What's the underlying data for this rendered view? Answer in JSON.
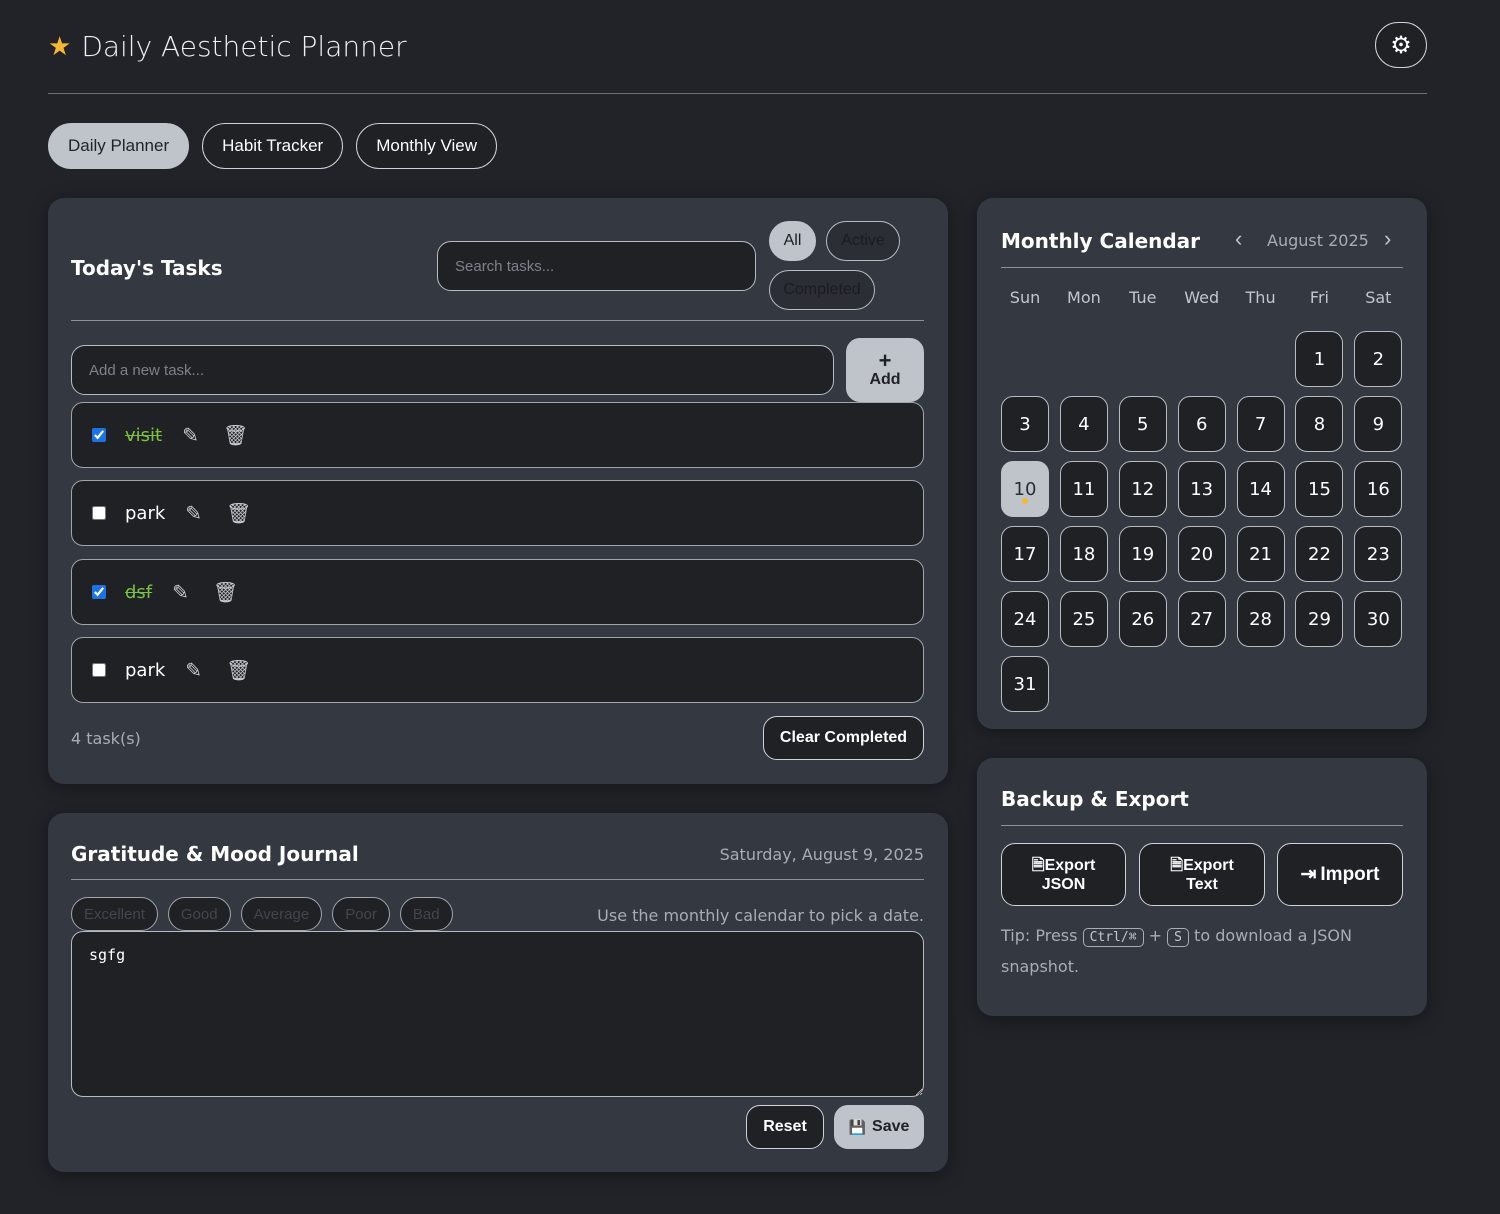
{
  "header": {
    "title": "Daily Aesthetic Planner",
    "star_icon": "star-icon",
    "theme_icon": "gear-icon"
  },
  "tabs": [
    {
      "label": "Daily Planner",
      "active": true
    },
    {
      "label": "Habit Tracker"
    },
    {
      "label": "Monthly View"
    }
  ],
  "tasks_card": {
    "title": "Today's Tasks",
    "search_placeholder": "Search tasks...",
    "filters": {
      "all": "All",
      "active": "Active",
      "completed": "Completed"
    },
    "add_placeholder": "Add a new task...",
    "add_plus": "+",
    "add_label": "Add",
    "items": [
      {
        "text": "visit",
        "done": true
      },
      {
        "text": "park",
        "done": false
      },
      {
        "text": "dsf",
        "done": true
      },
      {
        "text": "park",
        "done": false
      }
    ],
    "count": "4 task(s)",
    "clear_label": "Clear Completed"
  },
  "journal": {
    "title": "Gratitude & Mood Journal",
    "date": "Saturday, August 9, 2025",
    "moods": [
      "Excellent",
      "Good",
      "Average",
      "Poor",
      "Bad"
    ],
    "hint": "Use the monthly calendar to pick a date.",
    "entry": "sgfg",
    "reset_label": "Reset",
    "save_label": "Save"
  },
  "calendar": {
    "title": "Monthly Calendar",
    "month": "August 2025",
    "weekdays": [
      "Sun",
      "Mon",
      "Tue",
      "Wed",
      "Thu",
      "Fri",
      "Sat"
    ],
    "first_weekday": 5,
    "days": 31,
    "today": 10
  },
  "backup": {
    "title": "Backup & Export",
    "export_json": [
      "Export",
      "JSON"
    ],
    "export_text": [
      "Export",
      "Text"
    ],
    "import": "Import",
    "tip_prefix": "Tip: Press",
    "key1": "Ctrl/⌘",
    "plus": "+",
    "key2": "S",
    "tip_suffix": "to download a JSON snapshot."
  }
}
